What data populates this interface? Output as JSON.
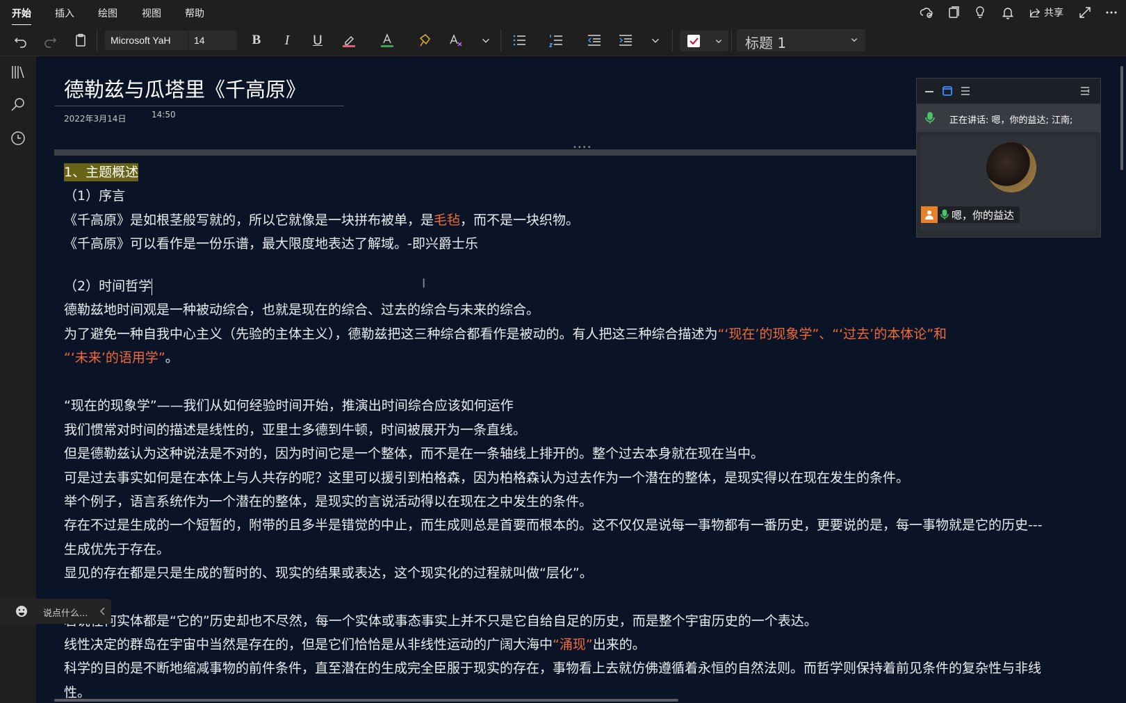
{
  "menu": {
    "tabs": [
      "开始",
      "插入",
      "绘图",
      "视图",
      "帮助"
    ],
    "share_label": "共享"
  },
  "toolbar": {
    "font_name": "Microsoft YaH",
    "font_size": "14",
    "paragraph_style": "标题 1"
  },
  "page": {
    "title": "德勒兹与瓜塔里《千高原》",
    "date": "2022年3月14日",
    "time": "14:50"
  },
  "content": {
    "l1": "1、主题概述",
    "l2": "（1）序言",
    "l3a": "《千高原》是如根茎般写就的，所以它就像是一块拼布被单，是",
    "l3b": "毛毡",
    "l3c": "，而不是一块织物。",
    "l4": "《千高原》可以看作是一份乐谱，最大限度地表达了解域。-即兴爵士乐",
    "l5": "（2）时间哲学",
    "l6": "德勒兹地时间观是一种被动综合，也就是现在的综合、过去的综合与未来的综合。",
    "l7a": "为了避免一种自我中心主义（先验的主体主义），德勒兹把这三种综合都看作是被动的。有人把这三种综合描述为",
    "l7b": "“‘现在’的现象学”、“‘过去’的本体论”和",
    "l8a": "“‘未来’的语用学”",
    "l8b": "。",
    "l9": "“现在的现象学”——我们从如何经验时间开始，推演出时间综合应该如何运作",
    "l10": "我们惯常对时间的描述是线性的，亚里士多德到牛顿，时间被展开为一条直线。",
    "l11": "但是德勒兹认为这种说法是不对的，因为时间它是一个整体，而不是在一条轴线上排开的。整个过去本身就在现在当中。",
    "l12": "可是过去事实如何是在本体上与人共存的呢？这里可以援引到柏格森，因为柏格森认为过去作为一个潜在的整体，是现实得以在现在发生的条件。",
    "l13": "举个例子，语言系统作为一个潜在的整体，是现实的言说活动得以在现在之中发生的条件。",
    "l14": "存在不过是生成的一个短暂的，附带的且多半是错觉的中止，而生成则总是首要而根本的。这不仅仅是说每一事物都有一番历史，更要说的是，每一事物就是它的历史---",
    "l15": "生成优先于存在。",
    "l16": "显见的存在都是只是生成的暂时的、现实的结果或表达，这个现实化的过程就叫做“层化”。",
    "l17": "若说任何实体都是“它的”历史却也不尽然，每一个实体或事态事实上并不只是它自给自足的历史，而是整个宇宙历史的一个表达。",
    "l18a": "线性决定的群岛在宇宙中当然是存在的，但是它们恰恰是从非线性运动的广阔大海中",
    "l18b": "“涌现”",
    "l18c": "出来的。",
    "l19": "科学的目的是不断地缩减事物的前件条件，直至潜在的生成完全臣服于现实的存在，事物看上去就仿佛遵循着永恒的自然法则。而哲学则保持着前见条件的复杂性与非线",
    "l20": "性。"
  },
  "meeting": {
    "speaking": "正在讲话: 嗯，你的益达; 江南;",
    "participant": "嗯，你的益达"
  },
  "chat": {
    "placeholder": "说点什么..."
  }
}
